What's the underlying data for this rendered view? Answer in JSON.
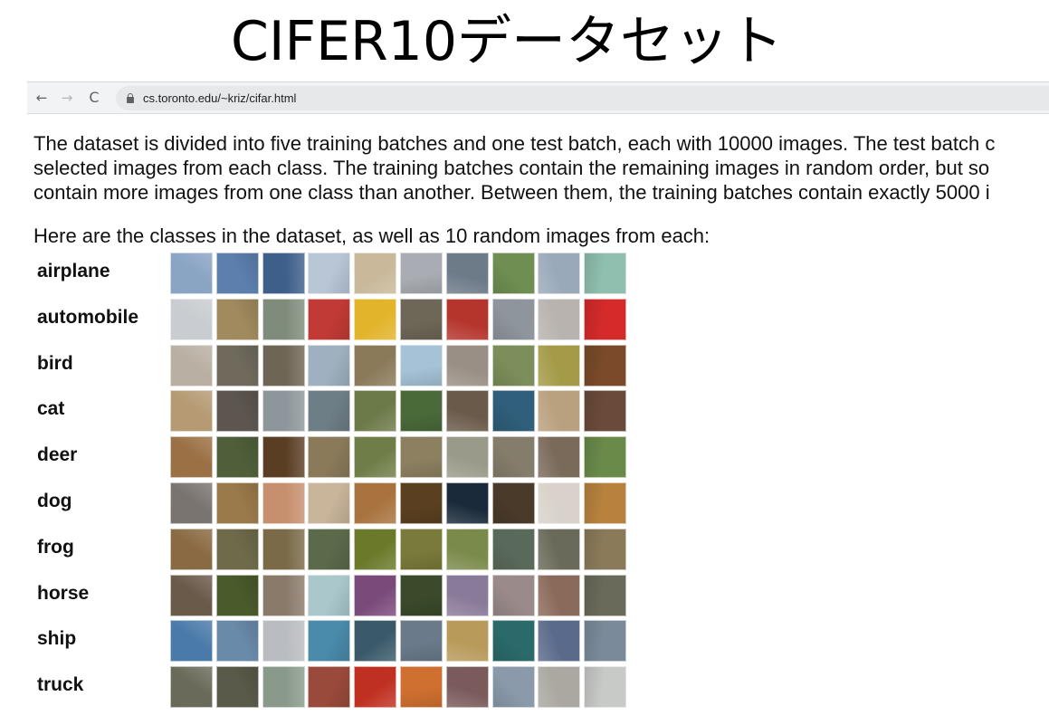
{
  "slide": {
    "title": "CIFER10データセット"
  },
  "browser": {
    "back_icon": "arrow-left-icon",
    "forward_icon": "arrow-right-icon",
    "reload_icon": "reload-icon",
    "back_glyph": "←",
    "forward_glyph": "→",
    "reload_glyph": "C",
    "url": "cs.toronto.edu/~kriz/cifar.html"
  },
  "page": {
    "description_lines": [
      "The dataset is divided into five training batches and one test batch, each with 10000 images. The test batch c",
      "selected images from each class. The training batches contain the remaining images in random order, but so",
      "contain more images from one class than another. Between them, the training batches contain exactly 5000 i"
    ],
    "intro": "Here are the classes in the dataset, as well as 10 random images from each:"
  },
  "classes": [
    {
      "label": "airplane",
      "thumb_colors": [
        "#8aa4c4",
        "#5c7fae",
        "#3d5f8a",
        "#b8c6d6",
        "#c9b89a",
        "#a9adb3",
        "#6d7a88",
        "#6f8f52",
        "#9aa9ba",
        "#8fbfae"
      ]
    },
    {
      "label": "automobile",
      "thumb_colors": [
        "#c9ccd0",
        "#a08a5e",
        "#7f8c7c",
        "#c23a35",
        "#e2b42a",
        "#6e6656",
        "#b5342c",
        "#8e959c",
        "#b8b3ae",
        "#d42a2a"
      ]
    },
    {
      "label": "bird",
      "thumb_colors": [
        "#b9b0a3",
        "#6f6a5c",
        "#6e6555",
        "#9fb1c0",
        "#8b7a5a",
        "#a6c2d6",
        "#9a8f85",
        "#7c8f5a",
        "#a49a48",
        "#7a4a2a"
      ]
    },
    {
      "label": "cat",
      "thumb_colors": [
        "#b59a73",
        "#5d5650",
        "#8d969b",
        "#6e7e86",
        "#6c7a48",
        "#4a6a3a",
        "#6a5a4a",
        "#2f5f7a",
        "#b9a07e",
        "#6a4a3a"
      ]
    },
    {
      "label": "deer",
      "thumb_colors": [
        "#9a7044",
        "#4f5f3a",
        "#5a3e24",
        "#8a7a5a",
        "#6f7e48",
        "#8c8060",
        "#9a9a8a",
        "#857d6b",
        "#7a6a5a",
        "#6a8a4a"
      ]
    },
    {
      "label": "dog",
      "thumb_colors": [
        "#7a7470",
        "#9a7a4a",
        "#c78f6e",
        "#c9b59a",
        "#a8733e",
        "#5a4020",
        "#1a2a3a",
        "#4a3a2a",
        "#d8d2ca",
        "#b8823e"
      ]
    },
    {
      "label": "frog",
      "thumb_colors": [
        "#8a6a42",
        "#6e6a4a",
        "#7a6a48",
        "#5a6a4a",
        "#6a7a2a",
        "#7a7a3a",
        "#7a8a4a",
        "#5a6a5a",
        "#6a6a5a",
        "#8a7a5a"
      ]
    },
    {
      "label": "horse",
      "thumb_colors": [
        "#6a5a4a",
        "#4a5a2a",
        "#8a7a6a",
        "#aac8cc",
        "#7a4a7a",
        "#3a4a2a",
        "#8a7a9a",
        "#9a8a8a",
        "#8a6a5a",
        "#6a6a5a"
      ]
    },
    {
      "label": "ship",
      "thumb_colors": [
        "#4a7aaa",
        "#6a8aaa",
        "#b9bcc0",
        "#4a8aaa",
        "#3a5a6a",
        "#6a7a8a",
        "#b89a5a",
        "#2a6a6a",
        "#5a6a8a",
        "#7a8a9a"
      ]
    },
    {
      "label": "truck",
      "thumb_colors": [
        "#6a6a5a",
        "#5a5a4a",
        "#8a9a8a",
        "#9a4a3a",
        "#c03020",
        "#d07030",
        "#7a5a5a",
        "#8a9aaa",
        "#aaa8a0",
        "#c8cac8"
      ]
    }
  ]
}
